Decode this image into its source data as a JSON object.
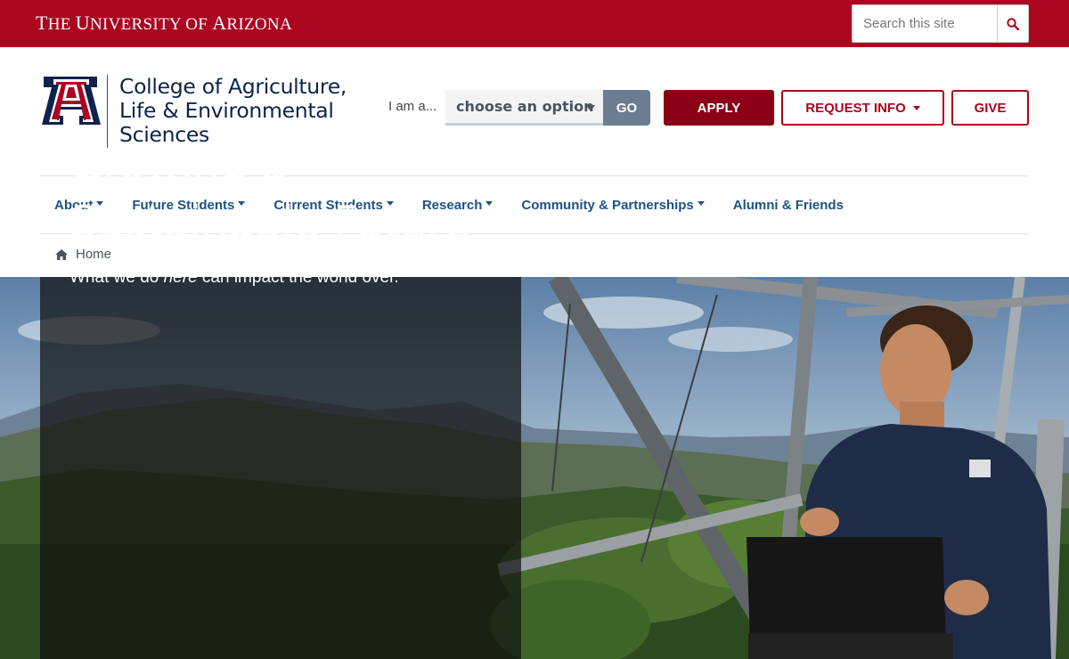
{
  "topbar": {
    "wordmark_t": "T",
    "wordmark_he": "he ",
    "wordmark_u": "U",
    "wordmark_niversity": "niversity of ",
    "wordmark_a": "A",
    "wordmark_rizona": "rizona",
    "search_placeholder": "Search this site",
    "search_icon": "search-icon"
  },
  "header": {
    "college_line1": "College of Agriculture,",
    "college_line2": "Life & Environmental",
    "college_line3": "Sciences",
    "iama_label": "I am a...",
    "iama_selected": "choose an option",
    "go_label": "GO",
    "apply_label": "APPLY",
    "request_info_label": "REQUEST INFO",
    "give_label": "GIVE"
  },
  "nav": {
    "items": [
      {
        "label": "About"
      },
      {
        "label": "Future Students"
      },
      {
        "label": "Current Students"
      },
      {
        "label": "Research"
      },
      {
        "label": "Community & Partnerships"
      },
      {
        "label": "Alumni & Friends"
      }
    ]
  },
  "breadcrumb": {
    "home_icon": "home-icon",
    "home_label": "Home"
  },
  "hero": {
    "title_line1": "Growing a",
    "title_line2": "Sustainable Future",
    "sub_before": "What we do ",
    "sub_em": "here",
    "sub_after": " can impact the world over."
  },
  "colors": {
    "brand_red": "#ab0520",
    "brand_blue": "#0c234b",
    "link_blue": "#1e5288",
    "dark_red": "#8b0015"
  }
}
